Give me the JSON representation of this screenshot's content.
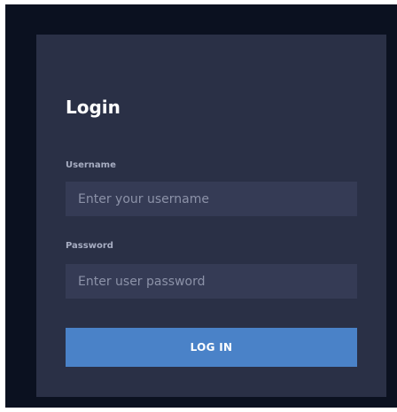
{
  "login": {
    "title": "Login",
    "username": {
      "label": "Username",
      "placeholder": "Enter your username",
      "value": ""
    },
    "password": {
      "label": "Password",
      "placeholder": "Enter user password",
      "value": ""
    },
    "submit_label": "LOG IN"
  },
  "colors": {
    "page_background": "#0b1120",
    "card_background": "#2a3046",
    "input_background": "#353b55",
    "label_text": "#a7adc2",
    "placeholder_text": "#8c92a8",
    "button_background": "#4a82c8",
    "button_text": "#ffffff"
  }
}
